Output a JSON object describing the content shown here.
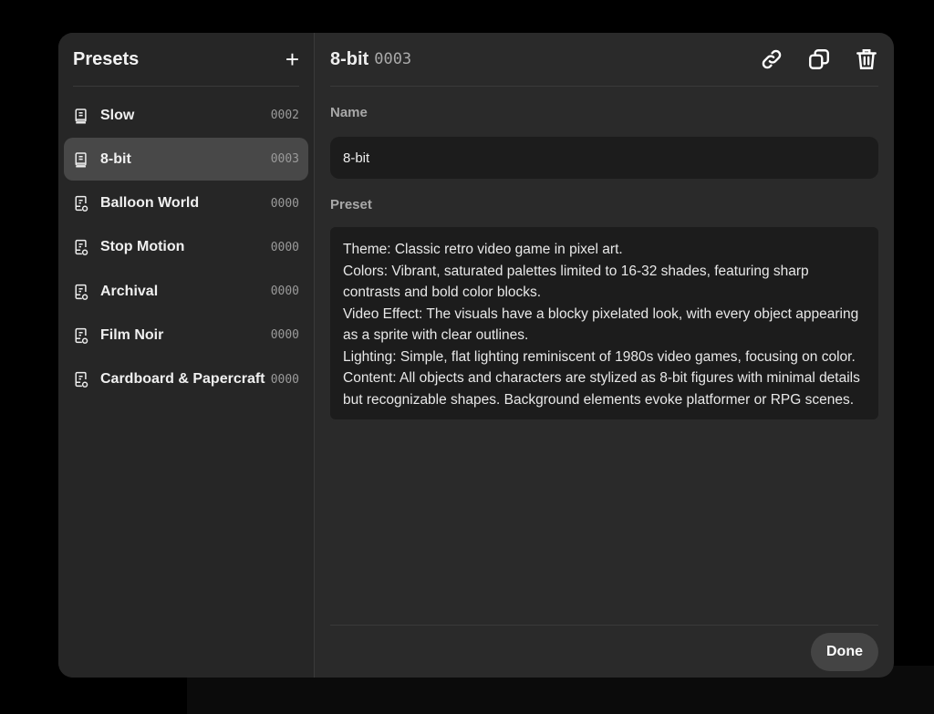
{
  "sidebar": {
    "title": "Presets",
    "add_icon": "plus-icon",
    "items": [
      {
        "label": "Slow",
        "count": "0002",
        "icon": "preset-book-icon"
      },
      {
        "label": "8-bit",
        "count": "0003",
        "icon": "preset-book-icon",
        "active": true
      },
      {
        "label": "Balloon World",
        "count": "0000",
        "icon": "preset-custom-icon"
      },
      {
        "label": "Stop Motion",
        "count": "0000",
        "icon": "preset-custom-icon"
      },
      {
        "label": "Archival",
        "count": "0000",
        "icon": "preset-custom-icon"
      },
      {
        "label": "Film Noir",
        "count": "0000",
        "icon": "preset-custom-icon"
      },
      {
        "label": "Cardboard & Papercraft",
        "count": "0000",
        "icon": "preset-custom-icon"
      }
    ]
  },
  "main": {
    "title": "8-bit",
    "number": "0003",
    "actions": [
      "link-icon",
      "duplicate-icon",
      "trash-icon"
    ],
    "name_label": "Name",
    "name_value": "8-bit",
    "preset_label": "Preset",
    "preset_value": "Theme: Classic retro video game in pixel art.\nColors: Vibrant, saturated palettes limited to 16-32 shades, featuring sharp contrasts and bold color blocks.\nVideo Effect: The visuals have a blocky pixelated look, with every object appearing as a sprite with clear outlines.\nLighting: Simple, flat lighting reminiscent of 1980s video games, focusing on color.\nContent: All objects and characters are stylized as 8-bit figures with minimal details but recognizable shapes. Background elements evoke platformer or RPG scenes.",
    "done_label": "Done"
  }
}
